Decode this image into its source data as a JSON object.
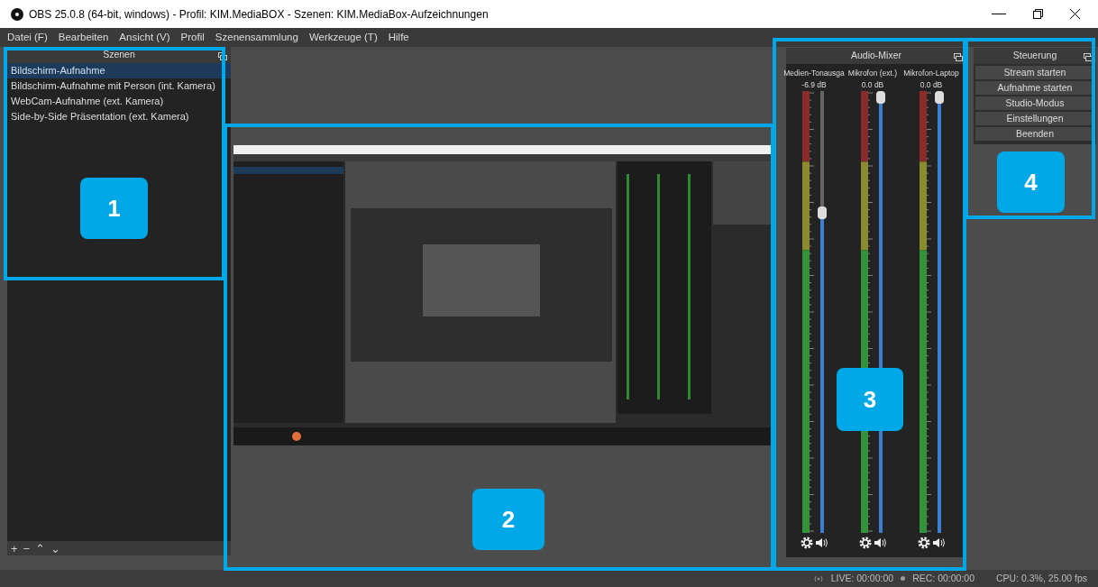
{
  "window": {
    "title": "OBS 25.0.8 (64-bit, windows) - Profil: KIM.MediaBOX - Szenen: KIM.MediaBox-Aufzeichnungen"
  },
  "menu": [
    "Datei (F)",
    "Bearbeiten",
    "Ansicht (V)",
    "Profil",
    "Szenensammlung",
    "Werkzeuge (T)",
    "Hilfe"
  ],
  "scenes": {
    "title": "Szenen",
    "items": [
      {
        "label": "Bildschirm-Aufnahme",
        "selected": true
      },
      {
        "label": "Bildschirm-Aufnahme mit Person (int. Kamera)",
        "selected": false
      },
      {
        "label": "WebCam-Aufnahme (ext. Kamera)",
        "selected": false
      },
      {
        "label": "Side-by-Side Präsentation (ext. Kamera)",
        "selected": false
      }
    ],
    "toolbar": [
      "+",
      "−",
      "⌃",
      "⌄"
    ]
  },
  "preview": {
    "kind": "screen"
  },
  "audio_mixer": {
    "title": "Audio-Mixer",
    "channels": [
      {
        "name": "Medien-Tonausga",
        "reading": "-6.9 dB",
        "level": 0.73
      },
      {
        "name": "Mikrofon (ext.)",
        "reading": "0.0 dB",
        "level": 1
      },
      {
        "name": "Mikrofon-Laptop",
        "reading": "0.0 dB",
        "level": 1
      }
    ]
  },
  "controls": {
    "title": "Steuerung",
    "buttons": [
      "Stream starten",
      "Aufnahme starten",
      "Studio-Modus",
      "Einstellungen",
      "Beenden"
    ]
  },
  "status_bar": {
    "live": "LIVE: 00:00:00",
    "rec": "REC: 00:00:00",
    "cpu": "CPU: 0.3%, 25.00 fps"
  },
  "annotations": [
    {
      "label": "1"
    },
    {
      "label": "2"
    },
    {
      "label": "3"
    },
    {
      "label": "4"
    }
  ]
}
